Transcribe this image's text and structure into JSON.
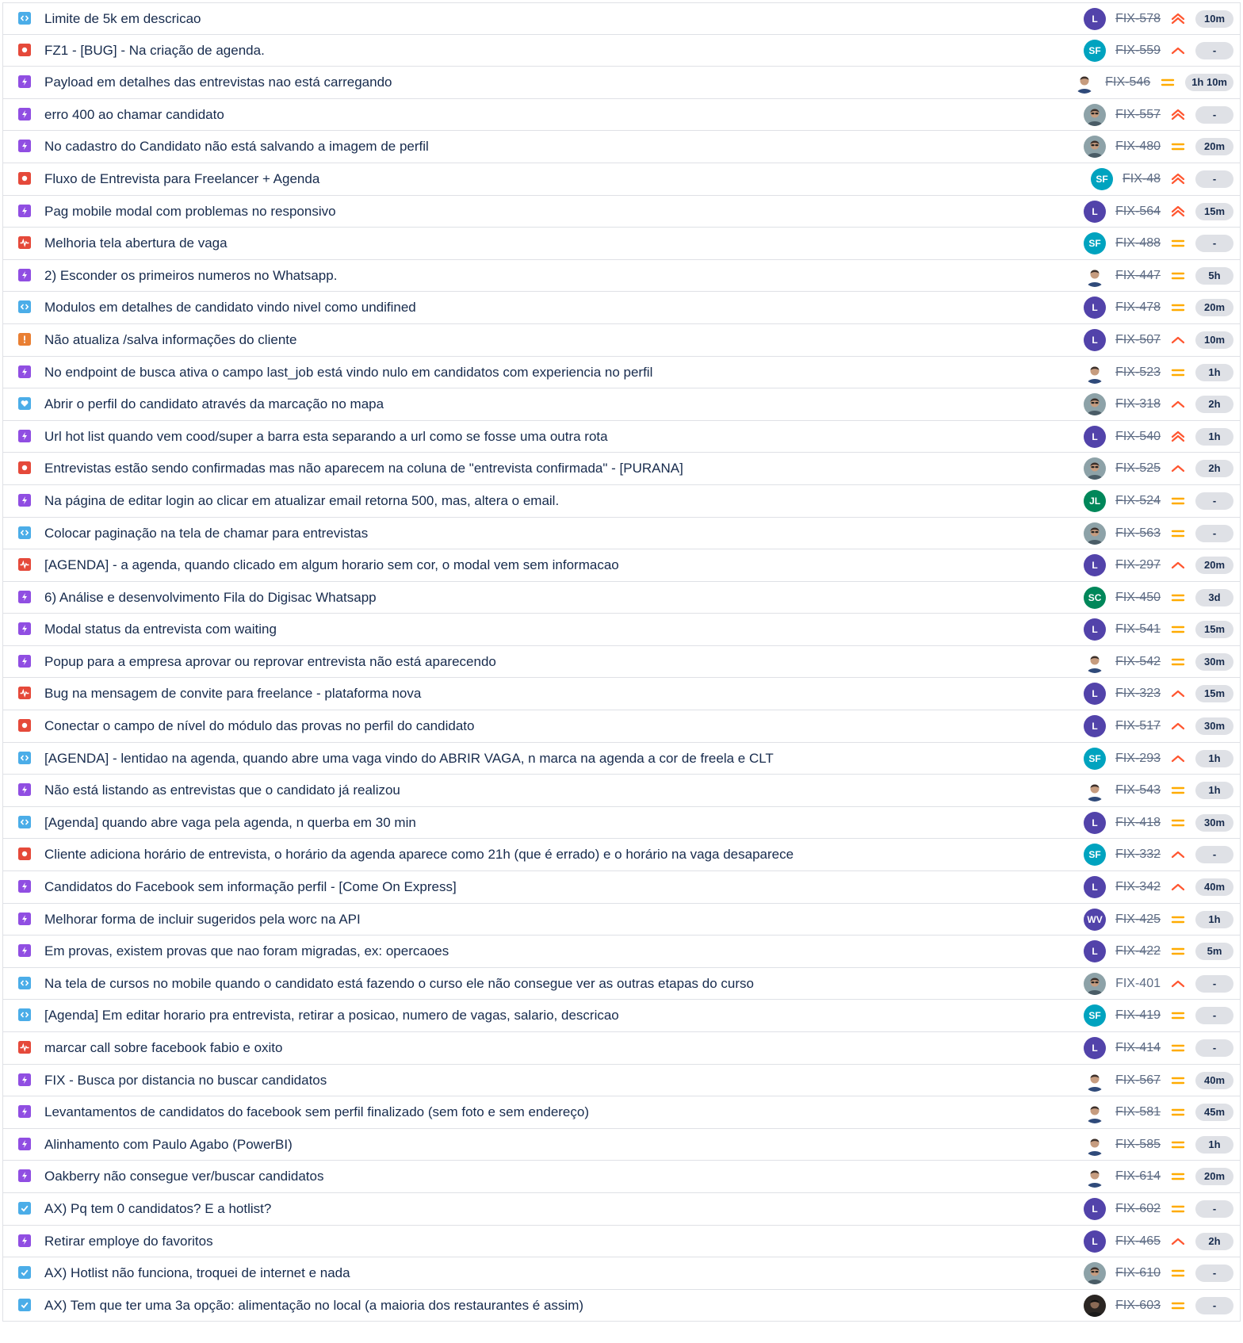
{
  "colors": {
    "task": "#904ee2",
    "bug": "#e5493a",
    "subtask": "#4bade8",
    "story": "#e97f33",
    "improvement": "#e5493a",
    "checkbox": "#4bade8",
    "heart": "#4bade8",
    "avatar_L": "#5243aa",
    "avatar_SF": "#00a3bf",
    "avatar_JL": "#00875a",
    "avatar_SC": "#00875a",
    "avatar_WV": "#5243aa",
    "priority_high": "#ff5630",
    "priority_medium": "#ffab00"
  },
  "issues": [
    {
      "summary": "Limite de 5k em descricao",
      "type": "subtask-icon",
      "avatar": "L",
      "key": "FIX-578",
      "priority": "highest",
      "estimate": "10m",
      "done": true
    },
    {
      "summary": "FZ1 - [BUG] - Na criação de agenda.",
      "type": "bug-icon",
      "avatar": "SF",
      "key": "FIX-559",
      "priority": "high",
      "estimate": "-",
      "done": true
    },
    {
      "summary": "Payload em detalhes das entrevistas nao está carregando",
      "type": "task-icon",
      "avatar": "photo-person",
      "key": "FIX-546",
      "priority": "medium",
      "estimate": "1h 10m",
      "done": true
    },
    {
      "summary": "erro 400 ao chamar candidato",
      "type": "task-icon",
      "avatar": "photo-glasses",
      "key": "FIX-557",
      "priority": "highest",
      "estimate": "-",
      "done": true
    },
    {
      "summary": "No cadastro do Candidato não está salvando a imagem de perfil",
      "type": "task-icon",
      "avatar": "photo-glasses",
      "key": "FIX-480",
      "priority": "medium",
      "estimate": "20m",
      "done": true
    },
    {
      "summary": "Fluxo de Entrevista para Freelancer + Agenda",
      "type": "bug-icon",
      "avatar": "SF",
      "key": "FIX-48",
      "priority": "highest",
      "estimate": "-",
      "done": true
    },
    {
      "summary": "Pag mobile modal com problemas no responsivo",
      "type": "task-icon",
      "avatar": "L",
      "key": "FIX-564",
      "priority": "highest",
      "estimate": "15m",
      "done": true
    },
    {
      "summary": "Melhoria tela abertura de vaga",
      "type": "improvement-icon",
      "avatar": "SF",
      "key": "FIX-488",
      "priority": "medium",
      "estimate": "-",
      "done": true
    },
    {
      "summary": "2) Esconder os primeiros numeros no Whatsapp.",
      "type": "task-icon",
      "avatar": "photo-person",
      "key": "FIX-447",
      "priority": "medium",
      "estimate": "5h",
      "done": true
    },
    {
      "summary": "Modulos em detalhes de candidato vindo nivel como undifined",
      "type": "subtask-icon",
      "avatar": "L",
      "key": "FIX-478",
      "priority": "medium",
      "estimate": "20m",
      "done": true
    },
    {
      "summary": "Não atualiza /salva informações do cliente",
      "type": "story-icon",
      "avatar": "L",
      "key": "FIX-507",
      "priority": "high",
      "estimate": "10m",
      "done": true
    },
    {
      "summary": "No endpoint de busca ativa o campo last_job está vindo nulo em candidatos com experiencia no perfil",
      "type": "task-icon",
      "avatar": "photo-person",
      "key": "FIX-523",
      "priority": "medium",
      "estimate": "1h",
      "done": true
    },
    {
      "summary": "Abrir o perfil do candidato através da marcação no mapa",
      "type": "heart-icon",
      "avatar": "photo-glasses",
      "key": "FIX-318",
      "priority": "high",
      "estimate": "2h",
      "done": true
    },
    {
      "summary": "Url hot list quando vem cood/super a barra esta separando a url como se fosse uma outra rota",
      "type": "task-icon",
      "avatar": "L",
      "key": "FIX-540",
      "priority": "highest",
      "estimate": "1h",
      "done": true
    },
    {
      "summary": "Entrevistas estão sendo confirmadas mas não aparecem na coluna de \"entrevista confirmada\" - [PURANA]",
      "type": "bug-icon",
      "avatar": "photo-glasses",
      "key": "FIX-525",
      "priority": "high",
      "estimate": "2h",
      "done": true
    },
    {
      "summary": "Na página de editar login ao clicar em atualizar email retorna 500, mas, altera o email.",
      "type": "task-icon",
      "avatar": "JL",
      "key": "FIX-524",
      "priority": "medium",
      "estimate": "-",
      "done": true
    },
    {
      "summary": "Colocar paginação na tela de chamar para entrevistas",
      "type": "subtask-icon",
      "avatar": "photo-glasses",
      "key": "FIX-563",
      "priority": "medium",
      "estimate": "-",
      "done": true
    },
    {
      "summary": "[AGENDA] - a agenda, quando clicado em algum horario sem cor, o modal vem sem informacao",
      "type": "improvement-icon",
      "avatar": "L",
      "key": "FIX-297",
      "priority": "high",
      "estimate": "20m",
      "done": true
    },
    {
      "summary": "6) Análise e desenvolvimento Fila do Digisac Whatsapp",
      "type": "task-icon",
      "avatar": "SC",
      "key": "FIX-450",
      "priority": "medium",
      "estimate": "3d",
      "done": true
    },
    {
      "summary": "Modal status da entrevista com waiting",
      "type": "task-icon",
      "avatar": "L",
      "key": "FIX-541",
      "priority": "medium",
      "estimate": "15m",
      "done": true
    },
    {
      "summary": "Popup para a empresa aprovar ou reprovar entrevista não está aparecendo",
      "type": "task-icon",
      "avatar": "photo-person",
      "key": "FIX-542",
      "priority": "medium",
      "estimate": "30m",
      "done": true
    },
    {
      "summary": "Bug na mensagem de convite para freelance - plataforma nova",
      "type": "improvement-icon",
      "avatar": "L",
      "key": "FIX-323",
      "priority": "high",
      "estimate": "15m",
      "done": true
    },
    {
      "summary": "Conectar o campo de nível do módulo das provas no perfil do candidato",
      "type": "bug-icon",
      "avatar": "L",
      "key": "FIX-517",
      "priority": "high",
      "estimate": "30m",
      "done": true
    },
    {
      "summary": "[AGENDA] - lentidao na agenda, quando abre uma vaga vindo do ABRIR VAGA, n marca na agenda a cor de freela e CLT",
      "type": "subtask-icon",
      "avatar": "SF",
      "key": "FIX-293",
      "priority": "high",
      "estimate": "1h",
      "done": true
    },
    {
      "summary": "Não está listando as entrevistas que o candidato já realizou",
      "type": "task-icon",
      "avatar": "photo-person",
      "key": "FIX-543",
      "priority": "medium",
      "estimate": "1h",
      "done": true
    },
    {
      "summary": "[Agenda] quando abre vaga pela agenda, n querba em 30 min",
      "type": "subtask-icon",
      "avatar": "L",
      "key": "FIX-418",
      "priority": "medium",
      "estimate": "30m",
      "done": true
    },
    {
      "summary": "Cliente adiciona horário de entrevista, o horário da agenda aparece como 21h (que é errado) e o horário na vaga desaparece",
      "type": "bug-icon",
      "avatar": "SF",
      "key": "FIX-332",
      "priority": "high",
      "estimate": "-",
      "done": true
    },
    {
      "summary": "Candidatos do Facebook sem informação perfil - [Come On Express]",
      "type": "task-icon",
      "avatar": "L",
      "key": "FIX-342",
      "priority": "high",
      "estimate": "40m",
      "done": true
    },
    {
      "summary": "Melhorar forma de incluir sugeridos pela worc na API",
      "type": "task-icon",
      "avatar": "WV",
      "key": "FIX-425",
      "priority": "medium",
      "estimate": "1h",
      "done": true
    },
    {
      "summary": "Em provas, existem provas que nao foram migradas, ex: opercaoes",
      "type": "task-icon",
      "avatar": "L",
      "key": "FIX-422",
      "priority": "medium",
      "estimate": "5m",
      "done": true
    },
    {
      "summary": "Na tela de cursos no mobile quando o candidato está fazendo o curso ele não consegue ver as outras etapas do curso",
      "type": "subtask-icon",
      "avatar": "photo-glasses",
      "key": "FIX-401",
      "priority": "high",
      "estimate": "-",
      "done": false
    },
    {
      "summary": "[Agenda] Em editar horario pra entrevista, retirar a posicao, numero de vagas, salario, descricao",
      "type": "subtask-icon",
      "avatar": "SF",
      "key": "FIX-419",
      "priority": "medium",
      "estimate": "-",
      "done": true
    },
    {
      "summary": "marcar call sobre facebook fabio e oxito",
      "type": "improvement-icon",
      "avatar": "L",
      "key": "FIX-414",
      "priority": "medium",
      "estimate": "-",
      "done": true
    },
    {
      "summary": "FIX - Busca por distancia no buscar candidatos",
      "type": "task-icon",
      "avatar": "photo-person",
      "key": "FIX-567",
      "priority": "medium",
      "estimate": "40m",
      "done": true
    },
    {
      "summary": "Levantamentos de candidatos do facebook sem perfil finalizado (sem foto e sem endereço)",
      "type": "task-icon",
      "avatar": "photo-person",
      "key": "FIX-581",
      "priority": "medium",
      "estimate": "45m",
      "done": true
    },
    {
      "summary": "Alinhamento com Paulo Agabo (PowerBI)",
      "type": "task-icon",
      "avatar": "photo-person",
      "key": "FIX-585",
      "priority": "medium",
      "estimate": "1h",
      "done": true
    },
    {
      "summary": "Oakberry não consegue ver/buscar candidatos",
      "type": "task-icon",
      "avatar": "photo-person",
      "key": "FIX-614",
      "priority": "medium",
      "estimate": "20m",
      "done": true
    },
    {
      "summary": "AX) Pq tem 0 candidatos? E a hotlist?",
      "type": "checkbox-icon",
      "avatar": "L",
      "key": "FIX-602",
      "priority": "medium",
      "estimate": "-",
      "done": true
    },
    {
      "summary": "Retirar employe do favoritos",
      "type": "task-icon",
      "avatar": "L",
      "key": "FIX-465",
      "priority": "high",
      "estimate": "2h",
      "done": true
    },
    {
      "summary": "AX) Hotlist não funciona, troquei de internet e nada",
      "type": "checkbox-icon",
      "avatar": "photo-glasses",
      "key": "FIX-610",
      "priority": "medium",
      "estimate": "-",
      "done": true
    },
    {
      "summary": "AX) Tem que ter uma 3a opção: alimentação no local (a maioria dos restaurantes é assim)",
      "type": "checkbox-icon",
      "avatar": "photo-dark",
      "key": "FIX-603",
      "priority": "medium",
      "estimate": "-",
      "done": true
    }
  ]
}
